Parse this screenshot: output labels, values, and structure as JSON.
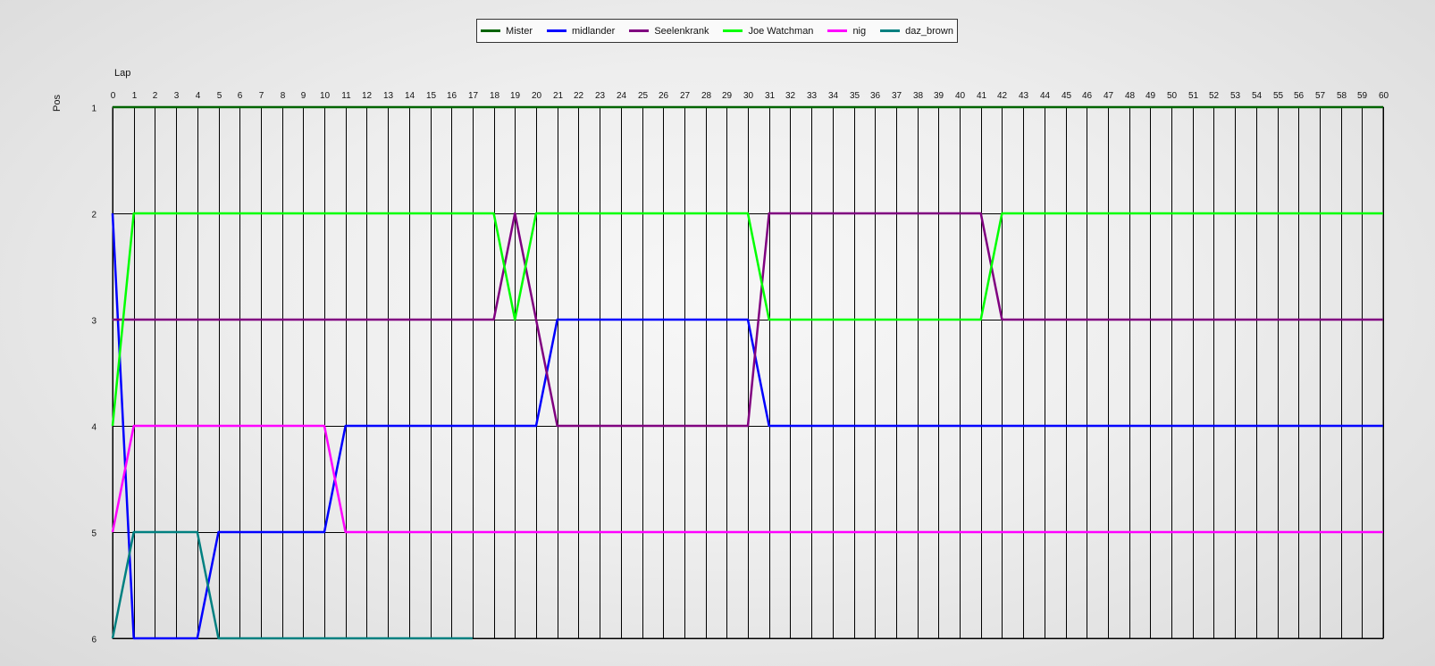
{
  "chart_data": {
    "type": "line",
    "xlabel": "Lap",
    "ylabel": "Pos",
    "xlim": [
      0,
      60
    ],
    "ylim": [
      1,
      6
    ],
    "y_inverted": true,
    "grid": "vertical-per-lap-and-horizontal-per-position",
    "legend_position": "top-center",
    "series": [
      {
        "name": "Mister",
        "color": "#006400",
        "points": [
          [
            0,
            1
          ],
          [
            60,
            1
          ]
        ]
      },
      {
        "name": "midlander",
        "color": "#0000ff",
        "points": [
          [
            0,
            2
          ],
          [
            1,
            6
          ],
          [
            4,
            6
          ],
          [
            5,
            5
          ],
          [
            10,
            5
          ],
          [
            11,
            4
          ],
          [
            20,
            4
          ],
          [
            21,
            3
          ],
          [
            30,
            3
          ],
          [
            31,
            4
          ],
          [
            60,
            4
          ]
        ]
      },
      {
        "name": "Seelenkrank",
        "color": "#800080",
        "points": [
          [
            0,
            3
          ],
          [
            18,
            3
          ],
          [
            19,
            2
          ],
          [
            20,
            3
          ],
          [
            21,
            4
          ],
          [
            30,
            4
          ],
          [
            31,
            2
          ],
          [
            41,
            2
          ],
          [
            42,
            3
          ],
          [
            60,
            3
          ]
        ]
      },
      {
        "name": "Joe Watchman",
        "color": "#00ff00",
        "points": [
          [
            0,
            4
          ],
          [
            1,
            2
          ],
          [
            18,
            2
          ],
          [
            19,
            3
          ],
          [
            20,
            2
          ],
          [
            30,
            2
          ],
          [
            31,
            3
          ],
          [
            41,
            3
          ],
          [
            42,
            2
          ],
          [
            60,
            2
          ]
        ]
      },
      {
        "name": "nig",
        "color": "#ff00ff",
        "points": [
          [
            0,
            5
          ],
          [
            1,
            4
          ],
          [
            10,
            4
          ],
          [
            11,
            5
          ],
          [
            60,
            5
          ]
        ]
      },
      {
        "name": "daz_brown",
        "color": "#008080",
        "points": [
          [
            0,
            6
          ],
          [
            1,
            5
          ],
          [
            4,
            5
          ],
          [
            5,
            6
          ],
          [
            17,
            6
          ]
        ]
      }
    ]
  }
}
